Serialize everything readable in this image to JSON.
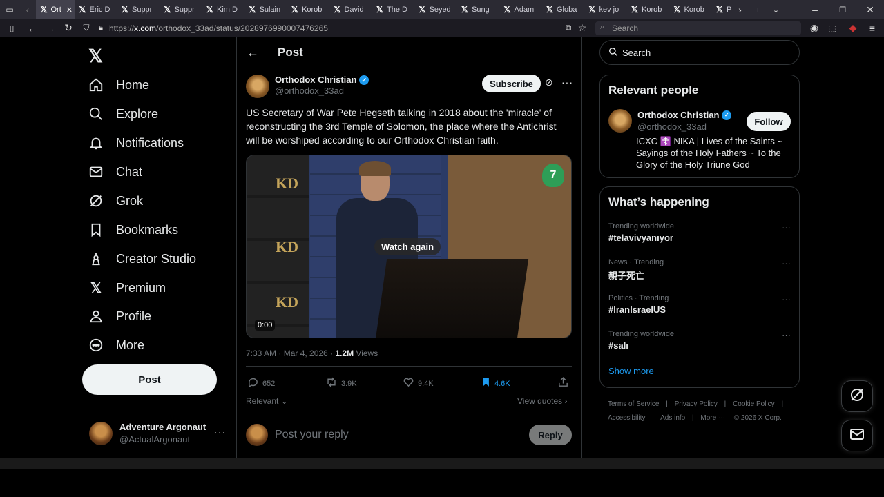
{
  "browser": {
    "tabs": [
      "Ort",
      "Eric D",
      "Suppr",
      "Suppr",
      "Kim D",
      "Sulain",
      "Korob",
      "David",
      "The D",
      "Seyed",
      "Sung",
      "Adam",
      "Globa",
      "kev jo",
      "Korob",
      "Korob",
      "P"
    ],
    "url_prefix": "https://",
    "url_host": "x.com",
    "url_path": "/orthodox_33ad/status/2028976990007476265",
    "search_placeholder": "Search"
  },
  "nav": {
    "items": [
      {
        "label": "Home",
        "icon": "home-icon"
      },
      {
        "label": "Explore",
        "icon": "search-icon"
      },
      {
        "label": "Notifications",
        "icon": "bell-icon"
      },
      {
        "label": "Chat",
        "icon": "mail-icon"
      },
      {
        "label": "Grok",
        "icon": "grok-icon"
      },
      {
        "label": "Bookmarks",
        "icon": "bookmark-icon"
      },
      {
        "label": "Creator Studio",
        "icon": "creator-icon"
      },
      {
        "label": "Premium",
        "icon": "x-icon"
      },
      {
        "label": "Profile",
        "icon": "person-icon"
      },
      {
        "label": "More",
        "icon": "more-icon"
      }
    ],
    "post_button": "Post",
    "account": {
      "name": "Adventure Argonaut",
      "handle": "@ActualArgonaut"
    }
  },
  "header": {
    "title": "Post"
  },
  "post": {
    "author_name": "Orthodox Christian",
    "author_handle": "@orthodox_33ad",
    "subscribe_label": "Subscribe",
    "text": "US Secretary of War Pete Hegseth talking in 2018 about the 'miracle' of reconstructing the 3rd Temple of Solomon, the place where the Antichrist will be worshiped according to our Orthodox Christian faith.",
    "video": {
      "watch_again": "Watch again",
      "time": "0:00"
    },
    "timestamp": "7:33 AM · Mar 4, 2026 · ",
    "views_count": "1.2M",
    "views_label": " Views",
    "stats": {
      "replies": "652",
      "reposts": "3.9K",
      "likes": "9.4K",
      "bookmarks": "4.6K"
    },
    "sort_label": "Relevant",
    "view_quotes": "View quotes",
    "reply_placeholder": "Post your reply",
    "reply_button": "Reply"
  },
  "sidebar": {
    "search_placeholder": "Search",
    "relevant_people": {
      "title": "Relevant people",
      "name": "Orthodox Christian",
      "handle": "@orthodox_33ad",
      "follow_label": "Follow",
      "bio": "ICXC ☦️ NIKA | Lives of the Saints ~ Sayings of the Holy Fathers ~ To the Glory of the Holy Triune God"
    },
    "happening": {
      "title": "What’s happening",
      "trends": [
        {
          "context": "Trending worldwide",
          "name": "#telavivyanıyor"
        },
        {
          "context": "News · Trending",
          "name": "親子死亡"
        },
        {
          "context": "Politics · Trending",
          "name": "#IranIsraelUS"
        },
        {
          "context": "Trending worldwide",
          "name": "#salı"
        }
      ],
      "show_more": "Show more"
    },
    "footer": {
      "line1": [
        "Terms of Service",
        "Privacy Policy",
        "Cookie Policy"
      ],
      "line2": [
        "Accessibility",
        "Ads info",
        "More ···",
        "© 2026 X Corp."
      ]
    }
  },
  "colors": {
    "accent": "#1d9bf0",
    "background": "#000000",
    "text": "#e7e9ea",
    "muted": "#71767b"
  }
}
